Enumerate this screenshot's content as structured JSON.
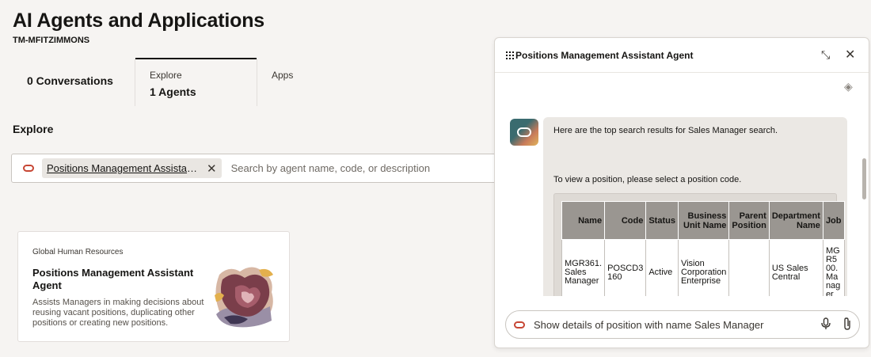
{
  "header": {
    "title": "AI Agents and Applications",
    "subtitle": "TM-MFITZIMMONS"
  },
  "tabs": [
    {
      "small": "",
      "big": "0 Conversations"
    },
    {
      "small": "Explore",
      "big": "1 Agents"
    },
    {
      "small": "Apps",
      "big": ""
    }
  ],
  "explore": {
    "title": "Explore",
    "chip_label": "Positions Management Assistant Agent",
    "placeholder": "Search by agent name, code, or description"
  },
  "card": {
    "category": "Global Human Resources",
    "title": "Positions Management Assistant Agent",
    "description": "Assists Managers in making decisions about reusing vacant positions, duplicating other positions or creating new positions."
  },
  "chat": {
    "title": "Positions Management Assistant Agent",
    "message_intro": "Here are the top search results for Sales Manager search.",
    "message_select": "To view a position, please select a position code.",
    "table": {
      "headers": [
        "Name",
        "Code",
        "Status",
        "Business Unit Name",
        "Parent Position",
        "Department Name",
        "Job"
      ],
      "rows": [
        [
          "MGR361. Sales Manager",
          "POSCD3 160",
          "Active",
          "Vision Corporation Enterprise",
          "",
          "US Sales Central",
          "MGR500.Manager"
        ]
      ]
    },
    "input_value": "Show details of position with name Sales Manager"
  },
  "colors": {
    "oracle_red": "#c74634",
    "background": "#f6f4f2",
    "table_header": "#9a9691"
  },
  "icons": [
    "oracle-logo-icon",
    "close-icon",
    "grid-icon",
    "minimize-icon",
    "layers-icon",
    "mic-icon",
    "paperclip-icon"
  ]
}
